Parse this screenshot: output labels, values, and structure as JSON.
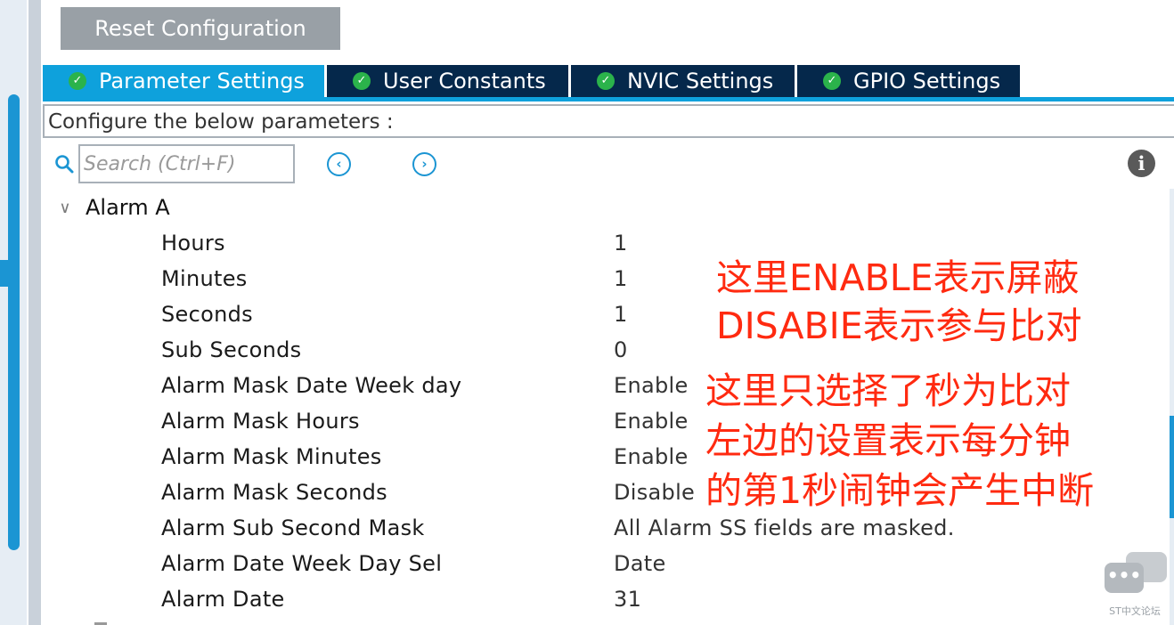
{
  "toolbar": {
    "reset_label": "Reset Configuration"
  },
  "tabs": [
    {
      "label": "Parameter Settings",
      "active": true
    },
    {
      "label": "User Constants",
      "active": false
    },
    {
      "label": "NVIC Settings",
      "active": false
    },
    {
      "label": "GPIO Settings",
      "active": false
    }
  ],
  "config_header": "Configure the below parameters :",
  "search": {
    "placeholder": "Search (Ctrl+F)",
    "value": ""
  },
  "group": {
    "label": "Alarm A",
    "expanded": true
  },
  "params": [
    {
      "name": "Hours",
      "value": "1"
    },
    {
      "name": "Minutes",
      "value": "1"
    },
    {
      "name": "Seconds",
      "value": "1"
    },
    {
      "name": "Sub Seconds",
      "value": "0"
    },
    {
      "name": "Alarm Mask Date Week day",
      "value": "Enable"
    },
    {
      "name": "Alarm Mask Hours",
      "value": "Enable"
    },
    {
      "name": "Alarm Mask Minutes",
      "value": "Enable"
    },
    {
      "name": "Alarm Mask Seconds",
      "value": "Disable"
    },
    {
      "name": "Alarm Sub Second Mask",
      "value": "All Alarm SS fields are masked."
    },
    {
      "name": "Alarm Date Week Day Sel",
      "value": "Date"
    },
    {
      "name": "Alarm Date",
      "value": "31"
    }
  ],
  "annotations": [
    "这里ENABLE表示屏蔽",
    "DISABIE表示参与比对",
    "这里只选择了秒为比对",
    "左边的设置表示每分钟",
    "的第1秒闹钟会产生中断"
  ],
  "watermark": {
    "text": "ST中文论坛"
  },
  "icons": {
    "tab_status": "check-circle-icon",
    "search": "search-icon",
    "prev": "arrow-left-circle-icon",
    "next": "arrow-right-circle-icon",
    "info": "info-icon",
    "collapse": "chevron-down-icon"
  },
  "colors": {
    "tab_active": "#0ea1dc",
    "tab_inactive": "#05284b",
    "tab_check": "#2bb34b",
    "annotation": "#ff2a10",
    "accent": "#1b95d3"
  }
}
